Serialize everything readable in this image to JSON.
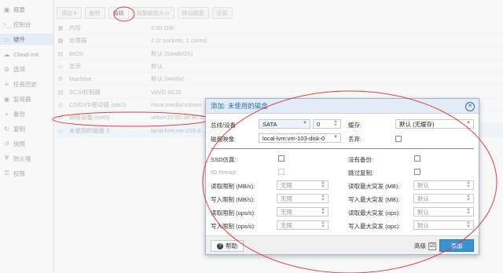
{
  "sidebar": {
    "items": [
      {
        "label": "概要",
        "icon": "book-icon",
        "glyph": "▣"
      },
      {
        "label": "控制台",
        "icon": "terminal-icon",
        "glyph": ">_"
      },
      {
        "label": "硬件",
        "icon": "monitor-icon",
        "glyph": "▭"
      },
      {
        "label": "Cloud-Init",
        "icon": "cloud-icon",
        "glyph": "☁"
      },
      {
        "label": "选项",
        "icon": "gear-icon",
        "glyph": "⚙"
      },
      {
        "label": "任务历史",
        "icon": "list-icon",
        "glyph": "≡"
      },
      {
        "label": "监视器",
        "icon": "eye-icon",
        "glyph": "◉"
      },
      {
        "label": "备份",
        "icon": "floppy-icon",
        "glyph": "▪"
      },
      {
        "label": "复制",
        "icon": "sync-icon",
        "glyph": "↻"
      },
      {
        "label": "快照",
        "icon": "history-icon",
        "glyph": "↺"
      },
      {
        "label": "防火墙",
        "icon": "shield-icon",
        "glyph": "⛨"
      },
      {
        "label": "权限",
        "icon": "unlock-icon",
        "glyph": "⚿"
      }
    ]
  },
  "toolbar": {
    "add": "添加",
    "remove": "删除",
    "edit": "编辑",
    "resize": "调整磁盘大小",
    "move": "移动磁盘",
    "revert": "还原"
  },
  "hardware": {
    "rows": [
      {
        "icon": "memory-icon",
        "glyph": "▦",
        "name": "内存",
        "value": "2.00 GiB"
      },
      {
        "icon": "cpu-icon",
        "glyph": "▩",
        "name": "处理器",
        "value": "2 (2 sockets, 1 cores)"
      },
      {
        "icon": "bios-icon",
        "glyph": "▤",
        "name": "BIOS",
        "value": "默认 (SeaBIOS)"
      },
      {
        "icon": "display-icon",
        "glyph": "▭",
        "name": "显示",
        "value": "默认"
      },
      {
        "icon": "machine-icon",
        "glyph": "⚙",
        "name": "Machine",
        "value": "默认 (i440fx)"
      },
      {
        "icon": "scsi-icon",
        "glyph": "▤",
        "name": "SCSI控制器",
        "value": "VirtIO SCSI"
      },
      {
        "icon": "cdrom-icon",
        "glyph": "◎",
        "name": "CD/DVD驱动器 (ide2)",
        "value": "none,media=cdrom"
      },
      {
        "icon": "network-icon",
        "glyph": "⇄",
        "name": "网络设备 (net0)",
        "value": "virtio=22:50:38:9C:C..."
      },
      {
        "icon": "hdd-icon",
        "glyph": "▭",
        "name": "未使用的磁盘 0",
        "value": "local-lvm:vm-103-d..."
      }
    ]
  },
  "dialog": {
    "title": "添加: 未使用的磁盘",
    "bus_label": "总线/设备:",
    "bus_value": "SATA",
    "bus_index": "0",
    "cache_label": "缓存:",
    "cache_value": "默认 (无缓存)",
    "disk_image_label": "磁盘映像:",
    "disk_image_value": "local-lvm:vm-103-disk-0",
    "discard_label": "丢弃:",
    "ssd_label": "SSD仿真:",
    "no_backup_label": "没有备份:",
    "iothread_label": "IO thread:",
    "skip_replication_label": "跳过复制:",
    "read_limit_mb_label": "读取限制 (MB/s):",
    "read_limit_mb_value": "无限",
    "read_burst_mb_label": "读取最大突发 (MB):",
    "read_burst_mb_value": "默认",
    "write_limit_mb_label": "写入限制 (MB/s):",
    "write_limit_mb_value": "无限",
    "write_burst_mb_label": "写入最大突发 (MB):",
    "write_burst_mb_value": "默认",
    "read_limit_ops_label": "读取限制 (ops/s):",
    "read_limit_ops_value": "无限",
    "read_burst_ops_label": "读取最大突发 (ops):",
    "read_burst_ops_value": "默认",
    "write_limit_ops_label": "写入限制 (ops/s):",
    "write_limit_ops_value": "无限",
    "write_burst_ops_label": "写入最大突发 (ops):",
    "write_burst_ops_value": "默认",
    "help": "帮助",
    "advanced": "高级",
    "advanced_check": "☑",
    "add": "添加"
  },
  "colors": {
    "accent": "#3892d4",
    "title": "#2e6bb0",
    "annotation": "#e04040"
  }
}
